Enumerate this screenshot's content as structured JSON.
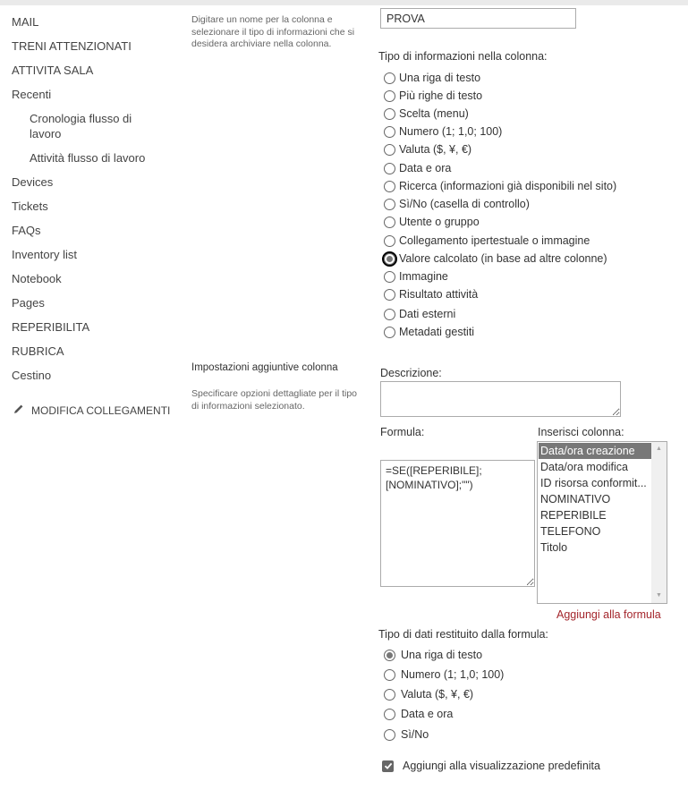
{
  "nav": {
    "items": [
      {
        "label": "MAIL"
      },
      {
        "label": "TRENI ATTENZIONATI"
      },
      {
        "label": "ATTIVITA SALA"
      },
      {
        "label": "Recenti"
      },
      {
        "label": "Cronologia flusso di lavoro",
        "sub": true
      },
      {
        "label": "Attività flusso di lavoro",
        "sub": true
      },
      {
        "label": "Devices"
      },
      {
        "label": "Tickets"
      },
      {
        "label": "FAQs"
      },
      {
        "label": "Inventory list"
      },
      {
        "label": "Notebook"
      },
      {
        "label": "Pages"
      },
      {
        "label": "REPERIBILITA"
      },
      {
        "label": "RUBRICA"
      },
      {
        "label": "Cestino"
      }
    ],
    "edit_links": {
      "icon": "pencil-icon",
      "label": "MODIFICA COLLEGAMENTI"
    }
  },
  "name_section": {
    "description": "Digitare un nome per la colonna e selezionare il tipo di informazioni che si desidera archiviare nella colonna.",
    "column_name_value": "PROVA",
    "type_label": "Tipo di informazioni nella colonna:",
    "types": [
      {
        "label": "Una riga di testo",
        "checked": false
      },
      {
        "label": "Più righe di testo",
        "checked": false
      },
      {
        "label": "Scelta (menu)",
        "checked": false
      },
      {
        "label": "Numero (1; 1,0; 100)",
        "checked": false
      },
      {
        "label": "Valuta ($, ¥, €)",
        "checked": false
      },
      {
        "label": "Data e ora",
        "checked": false
      },
      {
        "label": "Ricerca (informazioni già disponibili nel sito)",
        "checked": false
      },
      {
        "label": "Sì/No (casella di controllo)",
        "checked": false
      },
      {
        "label": "Utente o gruppo",
        "checked": false
      },
      {
        "label": "Collegamento ipertestuale o immagine",
        "checked": false
      },
      {
        "label": "Valore calcolato (in base ad altre colonne)",
        "checked": true
      },
      {
        "label": "Immagine",
        "checked": false
      },
      {
        "label": "Risultato attività",
        "checked": false
      },
      {
        "label": "Dati esterni",
        "checked": false
      },
      {
        "label": "Metadati gestiti",
        "checked": false
      }
    ]
  },
  "additional_section": {
    "title": "Impostazioni aggiuntive colonna",
    "description": "Specificare opzioni dettagliate per il tipo di informazioni selezionato.",
    "description_label": "Descrizione:",
    "description_value": "",
    "formula_label": "Formula:",
    "formula_value": "=SE([REPERIBILE];\n[NOMINATIVO];\"\")",
    "insert_column_label": "Inserisci colonna:",
    "columns": [
      {
        "label": "Data/ora creazione",
        "selected": true
      },
      {
        "label": "Data/ora modifica",
        "selected": false
      },
      {
        "label": "ID risorsa conformit...",
        "selected": false
      },
      {
        "label": "NOMINATIVO",
        "selected": false
      },
      {
        "label": "REPERIBILE",
        "selected": false
      },
      {
        "label": "TELEFONO",
        "selected": false
      },
      {
        "label": "Titolo",
        "selected": false
      }
    ],
    "add_to_formula": "Aggiungi alla formula",
    "return_type_label": "Tipo di dati restituito dalla formula:",
    "return_types": [
      {
        "label": "Una riga di testo",
        "checked": true
      },
      {
        "label": "Numero (1; 1,0; 100)",
        "checked": false
      },
      {
        "label": "Valuta ($, ¥, €)",
        "checked": false
      },
      {
        "label": "Data e ora",
        "checked": false
      },
      {
        "label": "Sì/No",
        "checked": false
      }
    ],
    "default_view_label": "Aggiungi alla visualizzazione predefinita",
    "default_view_checked": true
  },
  "colors": {
    "link": "#a4262c",
    "selected_option_bg": "#787878"
  }
}
